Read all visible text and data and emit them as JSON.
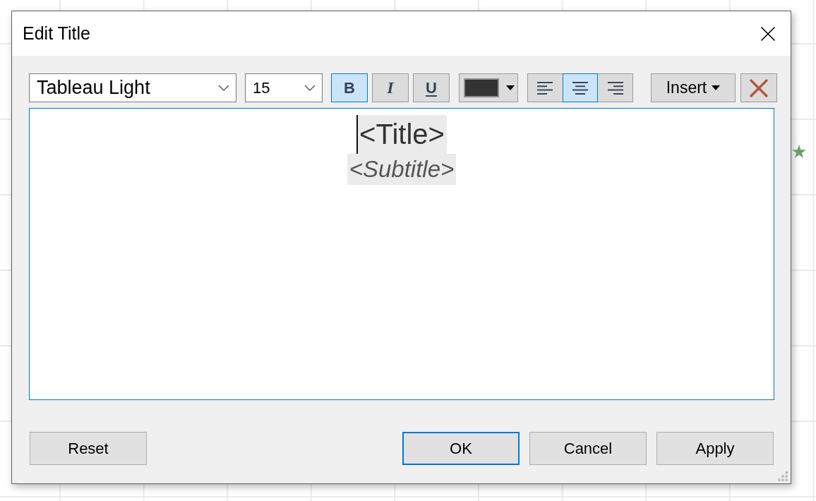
{
  "window": {
    "title": "Edit Title"
  },
  "toolbar": {
    "font": {
      "value": "Tableau Light"
    },
    "size": {
      "value": "15"
    },
    "styles": [
      {
        "kind": "bold",
        "label": "B",
        "selected": true
      },
      {
        "kind": "italic",
        "label": "I",
        "selected": false
      },
      {
        "kind": "underline",
        "label": "U",
        "selected": false
      }
    ],
    "text_color": {
      "color": "#333333"
    },
    "alignment": [
      {
        "kind": "left",
        "selected": false
      },
      {
        "kind": "center",
        "selected": true
      },
      {
        "kind": "right",
        "selected": false
      }
    ],
    "insert": {
      "label": "Insert"
    }
  },
  "editor": {
    "lines": [
      {
        "kind": "title",
        "text": "<Title>",
        "highlighted": true,
        "caret": true
      },
      {
        "kind": "subtitle",
        "text": "<Subtitle>",
        "highlighted": true,
        "caret": false
      }
    ]
  },
  "footer": {
    "left": [
      {
        "label": "Reset",
        "default": false
      }
    ],
    "right": [
      {
        "label": "OK",
        "default": true
      },
      {
        "label": "Cancel",
        "default": false
      },
      {
        "label": "Apply",
        "default": false
      }
    ]
  }
}
